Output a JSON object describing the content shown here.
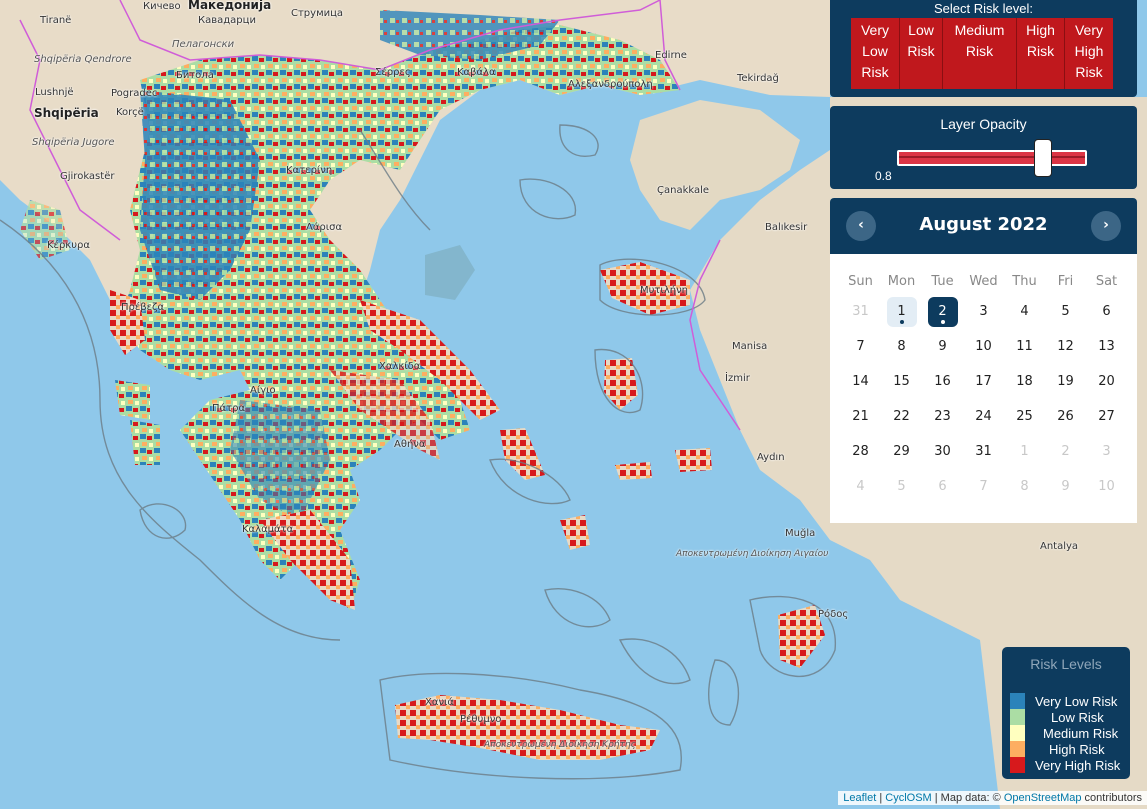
{
  "risk_selector": {
    "title": "Select Risk level:",
    "buttons": [
      "Very Low Risk",
      "Low Risk",
      "Medium Risk",
      "High Risk",
      "Very High Risk"
    ]
  },
  "opacity": {
    "title": "Layer Opacity",
    "value": "0.8"
  },
  "calendar": {
    "month_title": "August 2022",
    "prev_icon": "chevron-left-icon",
    "next_icon": "chevron-right-icon",
    "weekdays": [
      "Sun",
      "Mon",
      "Tue",
      "Wed",
      "Thu",
      "Fri",
      "Sat"
    ],
    "weeks": [
      [
        "31",
        "1",
        "2",
        "3",
        "4",
        "5",
        "6"
      ],
      [
        "7",
        "8",
        "9",
        "10",
        "11",
        "12",
        "13"
      ],
      [
        "14",
        "15",
        "16",
        "17",
        "18",
        "19",
        "20"
      ],
      [
        "21",
        "22",
        "23",
        "24",
        "25",
        "26",
        "27"
      ],
      [
        "28",
        "29",
        "30",
        "31",
        "1",
        "2",
        "3"
      ],
      [
        "4",
        "5",
        "6",
        "7",
        "8",
        "9",
        "10"
      ]
    ],
    "selected_day": "2",
    "days_with_data": [
      "1",
      "2"
    ]
  },
  "legend": {
    "title": "Risk Levels",
    "items": [
      {
        "label": "Very Low Risk",
        "color": "#2b83ba"
      },
      {
        "label": "Low Risk",
        "color": "#abdda4"
      },
      {
        "label": "Medium Risk",
        "color": "#ffffbf"
      },
      {
        "label": "High Risk",
        "color": "#fdae61"
      },
      {
        "label": "Very High Risk",
        "color": "#d7191c"
      }
    ]
  },
  "attribution": {
    "leaflet": "Leaflet",
    "sep1": " | ",
    "cyclosm": "CyclOSM",
    "mid": " | Map data: © ",
    "osm": "OpenStreetMap",
    "end": " contributors"
  },
  "map_labels": [
    "Tiranë",
    "Македонија",
    "Кичево",
    "Кавадарци",
    "Струмица",
    "Пелагонски",
    "Shqipëria Qendrore",
    "Битола",
    "Lushnjë",
    "Pogradec",
    "Shqipëria",
    "Korçë",
    "Shqipëria Jugore",
    "Gjirokastër",
    "Κέρκυρα",
    "Πρέβεζα",
    "Σέρρες",
    "Καβάλα",
    "Edirne",
    "Tekirdağ",
    "Αλεξανδρούπολη",
    "Çanakkale",
    "Balıkesir",
    "Μυτιλήνη",
    "Manisa",
    "İzmir",
    "Aydın",
    "Muğla",
    "Antalya",
    "Λάρισα",
    "Κατερίνη",
    "Πάτρα",
    "Αθήνα",
    "Χαλκίδα",
    "Αίγιο",
    "Καλαμάτα",
    "Χανιά",
    "Ρέθυμνο",
    "Ρόδος",
    "Αποκεντρωμένη Διοίκηση Αιγαίου",
    "Αποκεντρωμένη Διοίκηση Κρήτης"
  ]
}
